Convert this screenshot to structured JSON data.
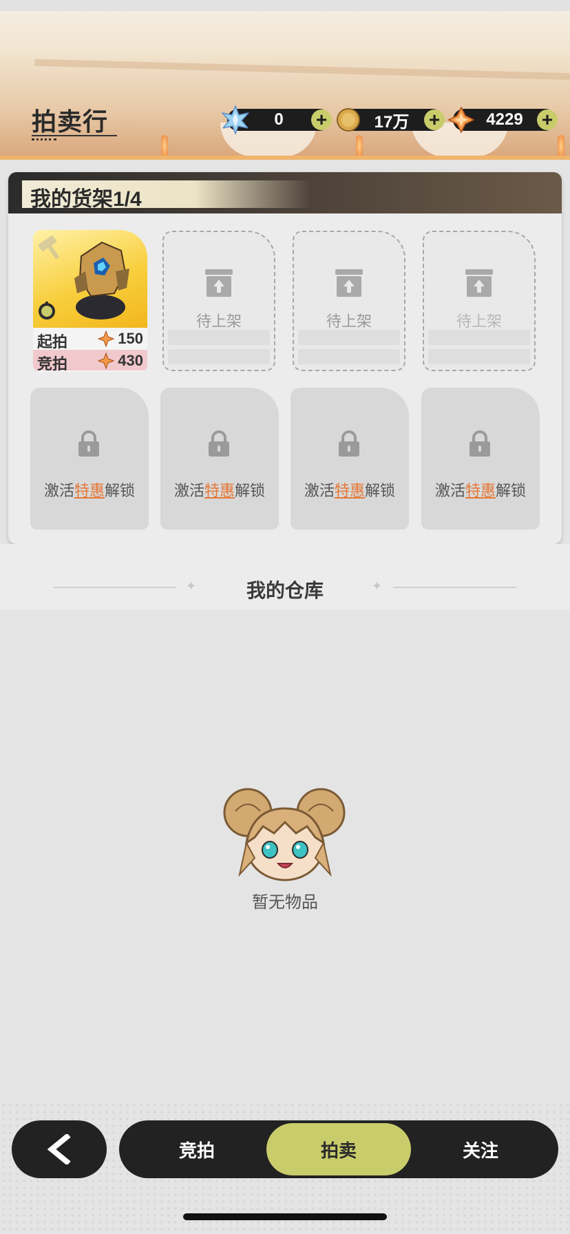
{
  "header": {
    "title": "拍卖行",
    "currencies": [
      {
        "icon": "crystal-icon",
        "value": "0",
        "plus": "+"
      },
      {
        "icon": "gold-coin-icon",
        "value": "17万",
        "plus": "+"
      },
      {
        "icon": "orange-gem-icon",
        "value": "4229",
        "plus": "+"
      }
    ]
  },
  "shelf": {
    "title": "我的货架1/4",
    "item": {
      "start_label": "起拍",
      "start_price": "150",
      "bid_label": "竞拍",
      "bid_price": "430"
    },
    "empty_slot_label": "待上架",
    "locked_slots": [
      {
        "prefix": "激活",
        "highlight": "特惠",
        "suffix": "解锁"
      },
      {
        "prefix": "激活",
        "highlight": "特惠",
        "suffix": "解锁"
      },
      {
        "prefix": "激活",
        "highlight": "特惠",
        "suffix": "解锁"
      },
      {
        "prefix": "激活",
        "highlight": "特惠",
        "suffix": "解锁"
      }
    ]
  },
  "warehouse": {
    "title": "我的仓库",
    "empty_text": "暂无物品"
  },
  "nav": {
    "tabs": [
      "竞拍",
      "拍卖",
      "关注"
    ],
    "active_tab": "拍卖"
  },
  "colors": {
    "accent": "#c9cc6a",
    "highlight": "#e57836",
    "dark": "#222222"
  }
}
